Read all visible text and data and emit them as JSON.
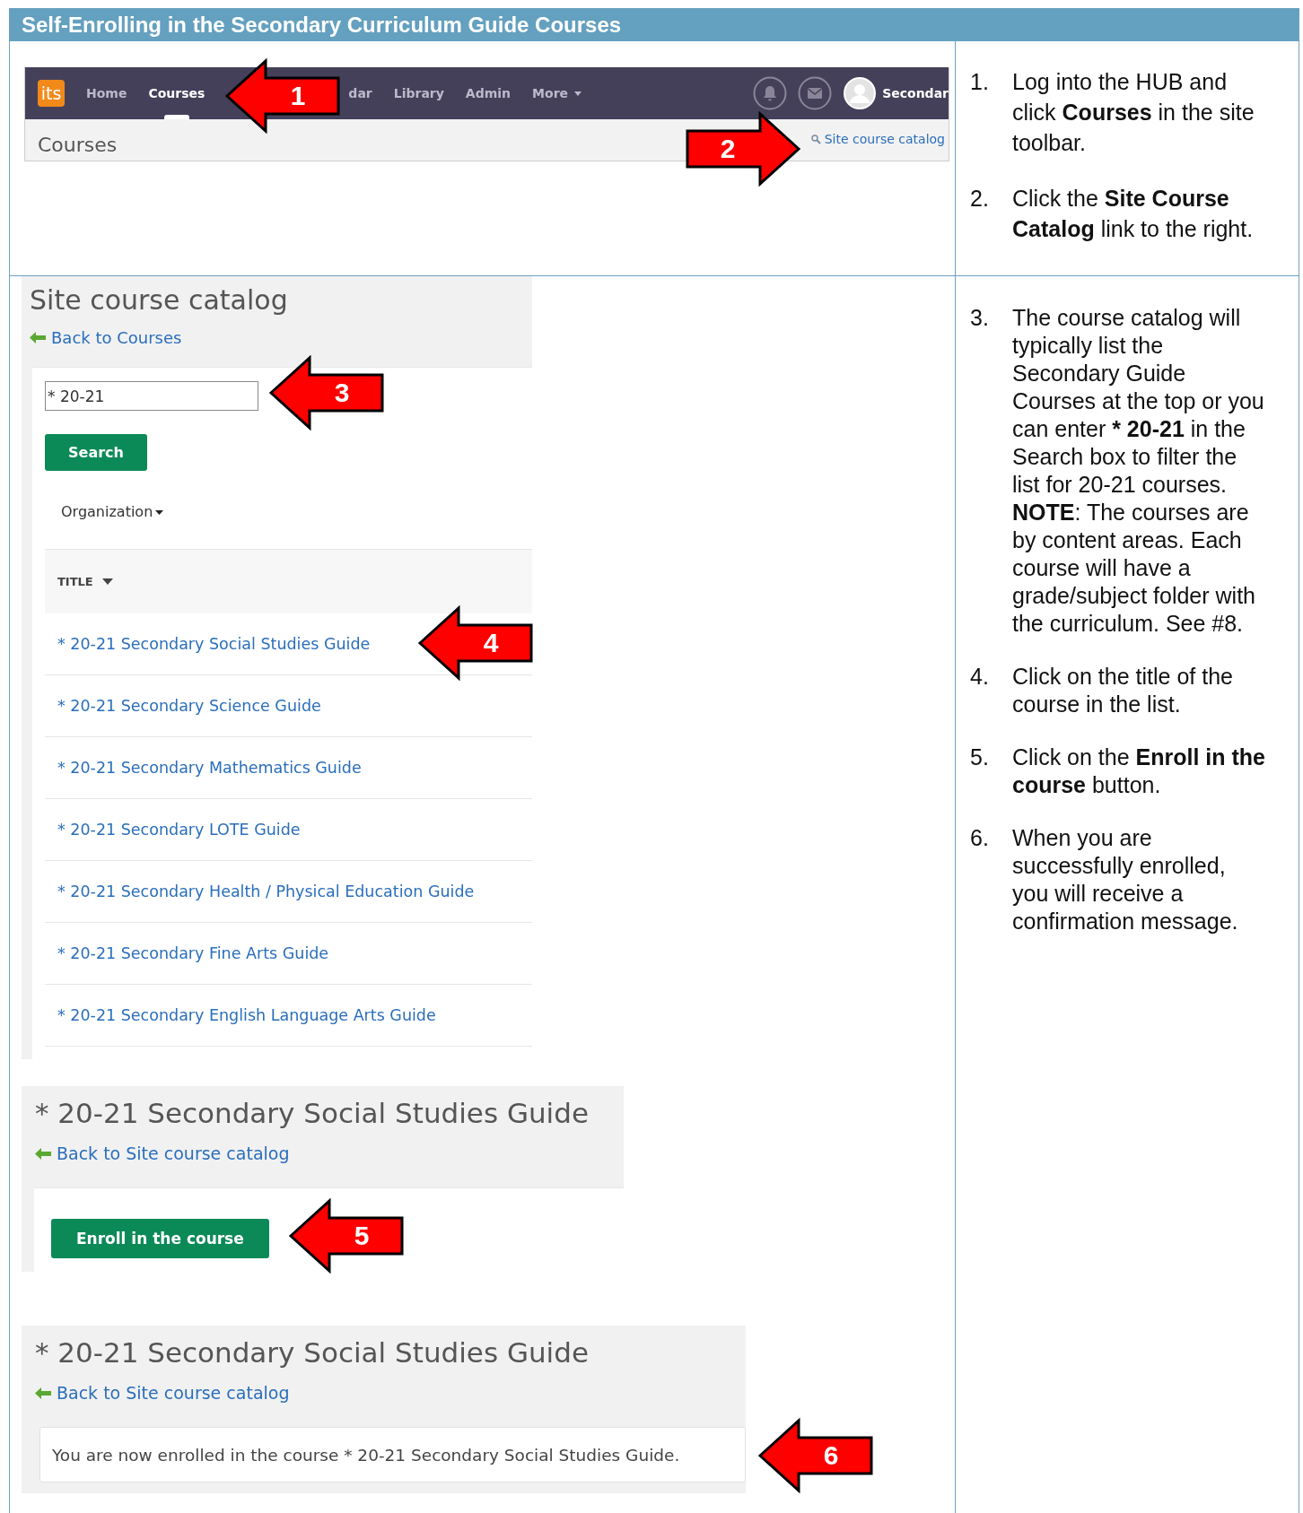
{
  "title": "Self-Enrolling in the Secondary Curriculum Guide Courses",
  "toolbar_screenshot": {
    "logo": "its",
    "nav": [
      {
        "label": "Home",
        "kind": "link",
        "selected": false
      },
      {
        "label": "Courses",
        "kind": "link",
        "selected": true
      },
      {
        "label": "dar",
        "kind": "partial",
        "selected": false
      },
      {
        "label": "Library",
        "kind": "link",
        "selected": false
      },
      {
        "label": "Admin",
        "kind": "link",
        "selected": false
      },
      {
        "label": "More",
        "kind": "dropdown",
        "selected": false
      }
    ],
    "user": "Secondar",
    "page_title": "Courses",
    "catalog_link": "Site course catalog"
  },
  "catalog_screenshot": {
    "title": "Site course catalog",
    "back_link": "Back to Courses",
    "search_value": "* 20-21",
    "search_button": "Search",
    "filter": "Organization",
    "column": "TITLE",
    "rows": [
      "* 20-21 Secondary Social Studies Guide",
      "* 20-21 Secondary Science Guide",
      "* 20-21 Secondary Mathematics Guide",
      "* 20-21 Secondary LOTE Guide",
      "* 20-21 Secondary Health / Physical Education Guide",
      "* 20-21 Secondary Fine Arts Guide",
      "* 20-21 Secondary English Language Arts Guide"
    ]
  },
  "enroll_screenshot": {
    "title": "* 20-21 Secondary Social Studies Guide",
    "back_link": "Back to Site course catalog",
    "button": "Enroll in the course"
  },
  "confirmation_screenshot": {
    "title": "* 20-21 Secondary Social Studies Guide",
    "back_link": "Back to Site course catalog",
    "message": "You are now enrolled in the course * 20-21 Secondary Social Studies Guide."
  },
  "callouts": [
    {
      "number": "1",
      "kind": "left"
    },
    {
      "number": "2",
      "kind": "right"
    },
    {
      "number": "3",
      "kind": "left"
    },
    {
      "number": "4",
      "kind": "left"
    },
    {
      "number": "5",
      "kind": "left"
    },
    {
      "number": "6",
      "kind": "left"
    }
  ],
  "steps_top": [
    {
      "number": "1.",
      "parts": [
        {
          "text": "Log into the HUB and click ",
          "bold": false
        },
        {
          "text": "Courses",
          "bold": true
        },
        {
          "text": " in the site toolbar.",
          "bold": false
        }
      ]
    },
    {
      "number": "2.",
      "parts": [
        {
          "text": "Click the ",
          "bold": false
        },
        {
          "text": "Site Course Catalog",
          "bold": true
        },
        {
          "text": " link to the right.",
          "bold": false
        }
      ]
    }
  ],
  "steps_bottom": [
    {
      "number": "3.",
      "parts": [
        {
          "text": "The course catalog will typically list the Secondary Guide Courses at the top or you can enter ",
          "bold": false
        },
        {
          "text": "* 20-21",
          "bold": true
        },
        {
          "text": " in the Search box to filter the list for 20-21 courses. ",
          "bold": false
        },
        {
          "text": "NOTE",
          "bold": true
        },
        {
          "text": ": The courses are by content areas. Each course will have a grade/subject folder with the curriculum. See #8.",
          "bold": false
        }
      ]
    },
    {
      "number": "4.",
      "parts": [
        {
          "text": "Click on the title of the course in the list.",
          "bold": false
        }
      ]
    },
    {
      "number": "5.",
      "parts": [
        {
          "text": "Click on the ",
          "bold": false
        },
        {
          "text": "Enroll in the course",
          "bold": true
        },
        {
          "text": " button.",
          "bold": false
        }
      ]
    },
    {
      "number": "6.",
      "parts": [
        {
          "text": "When you are successfully enrolled, you will receive a confirmation message.",
          "bold": false
        }
      ]
    }
  ]
}
